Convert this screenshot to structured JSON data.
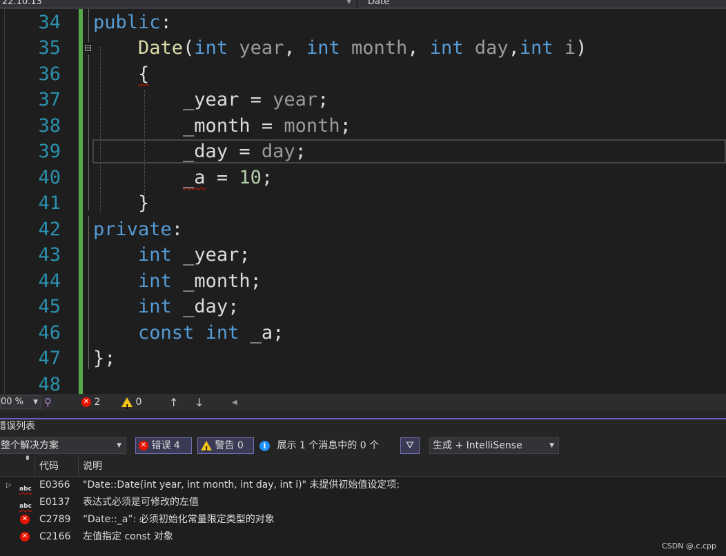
{
  "nav": {
    "left_value": "22.10.13",
    "right_value": "Date"
  },
  "editor": {
    "lines": [
      {
        "n": "34"
      },
      {
        "n": "35"
      },
      {
        "n": "36"
      },
      {
        "n": "37"
      },
      {
        "n": "38"
      },
      {
        "n": "39"
      },
      {
        "n": "40"
      },
      {
        "n": "41"
      },
      {
        "n": "42"
      },
      {
        "n": "43"
      },
      {
        "n": "44"
      },
      {
        "n": "45"
      },
      {
        "n": "46"
      },
      {
        "n": "47"
      },
      {
        "n": "48"
      }
    ],
    "tokens": {
      "public": "public",
      "colon": ":",
      "ctor": "Date",
      "lparen": "(",
      "int": "int",
      "year": "year",
      "comma": ",",
      "month": "month",
      "day": "day",
      "i": "i",
      "rparen": ")",
      "lbrace": "{",
      "rbrace": "}",
      "_year": "_year",
      "_month": "_month",
      "_day": "_day",
      "_a": "_a",
      "eq": "=",
      "semi": ";",
      "ten": "10",
      "private": "private",
      "const": "const",
      "closing": "};"
    }
  },
  "status": {
    "zoom": "00 %",
    "errors": "2",
    "warnings": "0"
  },
  "error_list": {
    "title": "错误列表",
    "scope": "整个解决方案",
    "errors_btn": "错误 4",
    "warnings_btn": "警告 0",
    "messages": "展示 1 个消息中的 0 个",
    "build_filter": "生成 + IntelliSense",
    "col_code": "代码",
    "col_desc": "说明",
    "rows": [
      {
        "code": "E0366",
        "desc": "\"Date::Date(int year, int month, int day, int i)\" 未提供初始值设定项:",
        "kind": "intellisense"
      },
      {
        "code": "E0137",
        "desc": "表达式必须是可修改的左值",
        "kind": "intellisense"
      },
      {
        "code": "C2789",
        "desc": "“Date::_a”: 必须初始化常量限定类型的对象",
        "kind": "error"
      },
      {
        "code": "C2166",
        "desc": "左值指定 const 对象",
        "kind": "error"
      }
    ]
  },
  "watermark": "CSDN @.c.cpp",
  "colors": {
    "keyword": "#569cd6",
    "function": "#dcdcaa",
    "line_number": "#2b91af",
    "change_bar": "#57a64a",
    "error_red": "#e51400"
  }
}
